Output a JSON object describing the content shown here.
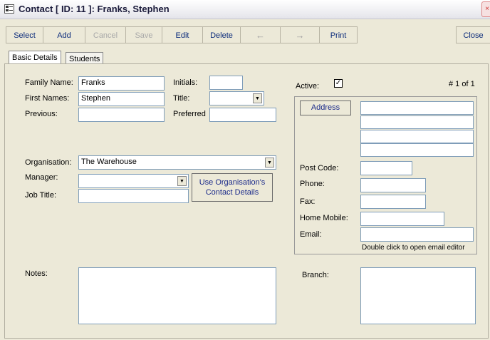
{
  "window": {
    "title": "Contact [ ID: 11 ]: Franks, Stephen",
    "close_glyph": "×"
  },
  "toolbar": {
    "select": "Select",
    "add": "Add",
    "cancel": "Cancel",
    "save": "Save",
    "edit": "Edit",
    "delete": "Delete",
    "prev_arrow": "←",
    "next_arrow": "→",
    "print": "Print",
    "close": "Close"
  },
  "tabs": [
    {
      "label": "Basic Details",
      "active": true
    },
    {
      "label": "Students",
      "active": false
    }
  ],
  "form": {
    "family_name_label": "Family Name:",
    "family_name_value": "Franks",
    "first_names_label": "First Names:",
    "first_names_value": "Stephen",
    "previous_label": "Previous:",
    "previous_value": "",
    "initials_label": "Initials:",
    "initials_value": "",
    "title_label": "Title:",
    "title_value": "",
    "preferred_label": "Preferred",
    "preferred_value": "",
    "organisation_label": "Organisation:",
    "organisation_value": "The Warehouse",
    "manager_label": "Manager:",
    "manager_value": "",
    "job_title_label": "Job Title:",
    "job_title_value": "",
    "use_org_button": "Use Organisation's Contact Details",
    "notes_label": "Notes:",
    "notes_value": ""
  },
  "side": {
    "active_label": "Active:",
    "active_checked": true,
    "active_mark": "✓",
    "record_counter": "# 1 of 1",
    "address_button": "Address",
    "address_lines": [
      "",
      "",
      "",
      ""
    ],
    "post_code_label": "Post Code:",
    "post_code_value": "",
    "phone_label": "Phone:",
    "phone_value": "",
    "fax_label": "Fax:",
    "fax_value": "",
    "home_mobile_label": "Home Mobile:",
    "home_mobile_value": "",
    "email_label": "Email:",
    "email_value": "",
    "email_hint": "Double click to open email editor",
    "branch_label": "Branch:",
    "branch_value": ""
  },
  "icons": {
    "window": "form-icon",
    "dropdown": "chevron-down-icon",
    "prev": "arrow-left-icon",
    "next": "arrow-right-icon"
  },
  "colors": {
    "background": "#ece9d8",
    "button_text": "#0a2a7a",
    "disabled_text": "#a9a9a9",
    "field_border": "#7f9db9"
  }
}
